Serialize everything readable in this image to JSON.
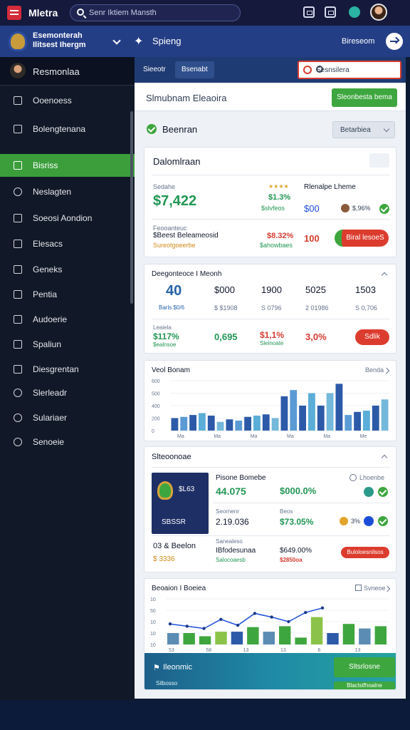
{
  "topbar": {
    "title": "Mletra",
    "search_placeholder": "Senr Iktiem Mansth"
  },
  "subbar": {
    "org_line1": "Esemonterah",
    "org_line2": "Ilitsest Ihergm",
    "section": "Spieng",
    "link": "Bireseom"
  },
  "sidebar": {
    "user": "Resmonlaa",
    "items": [
      {
        "label": "Ooenoess"
      },
      {
        "label": "Bolengtenana"
      },
      {
        "label": "Bisriss"
      },
      {
        "label": "Neslagten"
      },
      {
        "label": "Soeosi Aondion"
      },
      {
        "label": "Elesacs"
      },
      {
        "label": "Geneks"
      },
      {
        "label": "Pentia"
      },
      {
        "label": "Audoerie"
      },
      {
        "label": "Spaliun"
      },
      {
        "label": "Diesgrentan"
      },
      {
        "label": "Slerleadr"
      },
      {
        "label": "Sulariaer"
      },
      {
        "label": "Senoeie"
      }
    ]
  },
  "tabs": [
    {
      "label": "Sieeotr"
    },
    {
      "label": "Bsenabt"
    }
  ],
  "dropdown": {
    "value": "Sesnsilera"
  },
  "toolbar": {
    "title": "Slmubnam Eleaoira",
    "button": "Sleonbesta bema"
  },
  "section": {
    "label": "Beenran",
    "select": "Betarbiea"
  },
  "card1": {
    "title": "Dalomlraan",
    "row1": {
      "label": "Sedahe",
      "value": "$7,422",
      "mid_pct": "$1.3%",
      "mid_sub": "$slvfeos",
      "right_label": "Rlenalpe Lheme",
      "right_value": "$00",
      "right_pct": "$,96%"
    },
    "row2": {
      "label": "Feooanteuc",
      "line1": "$Beest Beleameosid",
      "line2": "Sureotgoeerbe",
      "value": "$8.32%",
      "sub": "$ahowbaes",
      "num": "100",
      "button": "Biral lesoeS"
    }
  },
  "card2": {
    "title": "Deegonteoce I Meonh",
    "cols": [
      {
        "top": "40",
        "sub": "Barls $0/6"
      },
      {
        "top": "$000",
        "sub": "$ $1908"
      },
      {
        "top": "1900",
        "sub": "S 0796"
      },
      {
        "top": "5025",
        "sub": "2 01986"
      },
      {
        "top": "1503",
        "sub": "S 0,706"
      }
    ],
    "row": {
      "label": "Leaiela",
      "value": "$117%",
      "sub": "$ealnsoe",
      "v2": "0,695",
      "v3": "$1,1%",
      "v3_sub": "Sleinoate",
      "v4": "3,0%",
      "button": "Sdlik"
    }
  },
  "card3": {
    "title": "Veol Bonam",
    "link": "Benda"
  },
  "card4": {
    "title": "Slteoonoae",
    "tile": {
      "code": "$L63",
      "caption": "SBSSR"
    },
    "col_title": "Pisone Bomebe",
    "v1": "44.075",
    "v2": "$000.0%",
    "right_label": "Lhoenbe",
    "r2_label": "Seornenr",
    "r2_value": "2.19.036",
    "r2_label2": "Beos",
    "r2_value2": "$73.05%",
    "r2_pct": "3%",
    "r3_label": "03 & Beelon",
    "r3_sub": "$ 3336",
    "r3_label2": "Sanealeso",
    "r3_value": "IBfodesunaa",
    "r3_sub2": "Salocoaesb",
    "r3_value2": "$649.00%",
    "r3_sub3": "$2850oa",
    "r3_button": "Buloloesnilsos"
  },
  "card5": {
    "title": "Beoaion I Boeiea",
    "link": "Svneoe",
    "footer_label": "Ileonmic",
    "footer_button": "Sltsrlosne",
    "footer_sub": "Silbosso",
    "footer_sub2": "Blaclstfhoalne"
  },
  "chart_data": [
    {
      "type": "bar",
      "title": "Veol Bonam",
      "ytick_labels": [
        "600",
        "500",
        "400",
        "200",
        "0"
      ],
      "xtick_labels": [
        "Ma",
        "Ma",
        "Ma",
        "Ma",
        "Ma",
        "Me"
      ],
      "series": [
        {
          "values": [
            20,
            22,
            25,
            28,
            24,
            14,
            18,
            16,
            22,
            24,
            26,
            20,
            55,
            65,
            40,
            60,
            40,
            60,
            75,
            25,
            30,
            32,
            40,
            50
          ]
        }
      ],
      "ylim": [
        0,
        80
      ]
    },
    {
      "type": "bar",
      "title": "Beoaion I Boeiea",
      "ytick_labels": [
        "10",
        "50",
        "10",
        "10",
        "10"
      ],
      "xtick_labels": [
        "53",
        "58",
        "13",
        "13",
        "6",
        "13"
      ],
      "series": [
        {
          "values": [
            25,
            25,
            18,
            28,
            28,
            38,
            28,
            40,
            15,
            60,
            25,
            45,
            35,
            40
          ]
        },
        {
          "values": [
            45,
            40,
            35,
            55,
            42,
            68,
            60,
            50,
            70,
            80
          ]
        }
      ],
      "ylim": [
        0,
        100
      ]
    }
  ],
  "colors": {
    "accent_green": "#3ea63e",
    "accent_red": "#dc3c2e",
    "nav_dark": "#111827",
    "header_blue": "#243e86"
  }
}
